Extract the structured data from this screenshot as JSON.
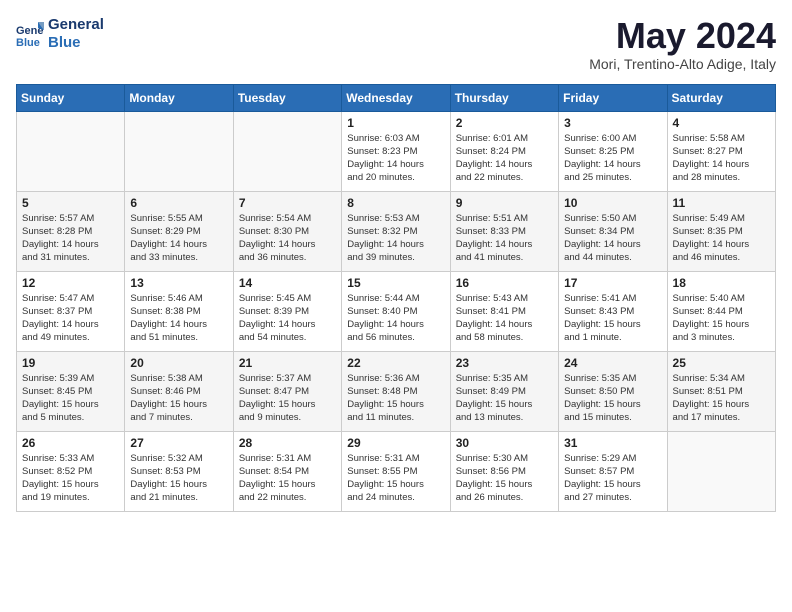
{
  "header": {
    "logo_line1": "General",
    "logo_line2": "Blue",
    "month_title": "May 2024",
    "subtitle": "Mori, Trentino-Alto Adige, Italy"
  },
  "weekdays": [
    "Sunday",
    "Monday",
    "Tuesday",
    "Wednesday",
    "Thursday",
    "Friday",
    "Saturday"
  ],
  "weeks": [
    [
      {
        "day": "",
        "info": ""
      },
      {
        "day": "",
        "info": ""
      },
      {
        "day": "",
        "info": ""
      },
      {
        "day": "1",
        "info": "Sunrise: 6:03 AM\nSunset: 8:23 PM\nDaylight: 14 hours\nand 20 minutes."
      },
      {
        "day": "2",
        "info": "Sunrise: 6:01 AM\nSunset: 8:24 PM\nDaylight: 14 hours\nand 22 minutes."
      },
      {
        "day": "3",
        "info": "Sunrise: 6:00 AM\nSunset: 8:25 PM\nDaylight: 14 hours\nand 25 minutes."
      },
      {
        "day": "4",
        "info": "Sunrise: 5:58 AM\nSunset: 8:27 PM\nDaylight: 14 hours\nand 28 minutes."
      }
    ],
    [
      {
        "day": "5",
        "info": "Sunrise: 5:57 AM\nSunset: 8:28 PM\nDaylight: 14 hours\nand 31 minutes."
      },
      {
        "day": "6",
        "info": "Sunrise: 5:55 AM\nSunset: 8:29 PM\nDaylight: 14 hours\nand 33 minutes."
      },
      {
        "day": "7",
        "info": "Sunrise: 5:54 AM\nSunset: 8:30 PM\nDaylight: 14 hours\nand 36 minutes."
      },
      {
        "day": "8",
        "info": "Sunrise: 5:53 AM\nSunset: 8:32 PM\nDaylight: 14 hours\nand 39 minutes."
      },
      {
        "day": "9",
        "info": "Sunrise: 5:51 AM\nSunset: 8:33 PM\nDaylight: 14 hours\nand 41 minutes."
      },
      {
        "day": "10",
        "info": "Sunrise: 5:50 AM\nSunset: 8:34 PM\nDaylight: 14 hours\nand 44 minutes."
      },
      {
        "day": "11",
        "info": "Sunrise: 5:49 AM\nSunset: 8:35 PM\nDaylight: 14 hours\nand 46 minutes."
      }
    ],
    [
      {
        "day": "12",
        "info": "Sunrise: 5:47 AM\nSunset: 8:37 PM\nDaylight: 14 hours\nand 49 minutes."
      },
      {
        "day": "13",
        "info": "Sunrise: 5:46 AM\nSunset: 8:38 PM\nDaylight: 14 hours\nand 51 minutes."
      },
      {
        "day": "14",
        "info": "Sunrise: 5:45 AM\nSunset: 8:39 PM\nDaylight: 14 hours\nand 54 minutes."
      },
      {
        "day": "15",
        "info": "Sunrise: 5:44 AM\nSunset: 8:40 PM\nDaylight: 14 hours\nand 56 minutes."
      },
      {
        "day": "16",
        "info": "Sunrise: 5:43 AM\nSunset: 8:41 PM\nDaylight: 14 hours\nand 58 minutes."
      },
      {
        "day": "17",
        "info": "Sunrise: 5:41 AM\nSunset: 8:43 PM\nDaylight: 15 hours\nand 1 minute."
      },
      {
        "day": "18",
        "info": "Sunrise: 5:40 AM\nSunset: 8:44 PM\nDaylight: 15 hours\nand 3 minutes."
      }
    ],
    [
      {
        "day": "19",
        "info": "Sunrise: 5:39 AM\nSunset: 8:45 PM\nDaylight: 15 hours\nand 5 minutes."
      },
      {
        "day": "20",
        "info": "Sunrise: 5:38 AM\nSunset: 8:46 PM\nDaylight: 15 hours\nand 7 minutes."
      },
      {
        "day": "21",
        "info": "Sunrise: 5:37 AM\nSunset: 8:47 PM\nDaylight: 15 hours\nand 9 minutes."
      },
      {
        "day": "22",
        "info": "Sunrise: 5:36 AM\nSunset: 8:48 PM\nDaylight: 15 hours\nand 11 minutes."
      },
      {
        "day": "23",
        "info": "Sunrise: 5:35 AM\nSunset: 8:49 PM\nDaylight: 15 hours\nand 13 minutes."
      },
      {
        "day": "24",
        "info": "Sunrise: 5:35 AM\nSunset: 8:50 PM\nDaylight: 15 hours\nand 15 minutes."
      },
      {
        "day": "25",
        "info": "Sunrise: 5:34 AM\nSunset: 8:51 PM\nDaylight: 15 hours\nand 17 minutes."
      }
    ],
    [
      {
        "day": "26",
        "info": "Sunrise: 5:33 AM\nSunset: 8:52 PM\nDaylight: 15 hours\nand 19 minutes."
      },
      {
        "day": "27",
        "info": "Sunrise: 5:32 AM\nSunset: 8:53 PM\nDaylight: 15 hours\nand 21 minutes."
      },
      {
        "day": "28",
        "info": "Sunrise: 5:31 AM\nSunset: 8:54 PM\nDaylight: 15 hours\nand 22 minutes."
      },
      {
        "day": "29",
        "info": "Sunrise: 5:31 AM\nSunset: 8:55 PM\nDaylight: 15 hours\nand 24 minutes."
      },
      {
        "day": "30",
        "info": "Sunrise: 5:30 AM\nSunset: 8:56 PM\nDaylight: 15 hours\nand 26 minutes."
      },
      {
        "day": "31",
        "info": "Sunrise: 5:29 AM\nSunset: 8:57 PM\nDaylight: 15 hours\nand 27 minutes."
      },
      {
        "day": "",
        "info": ""
      }
    ]
  ]
}
